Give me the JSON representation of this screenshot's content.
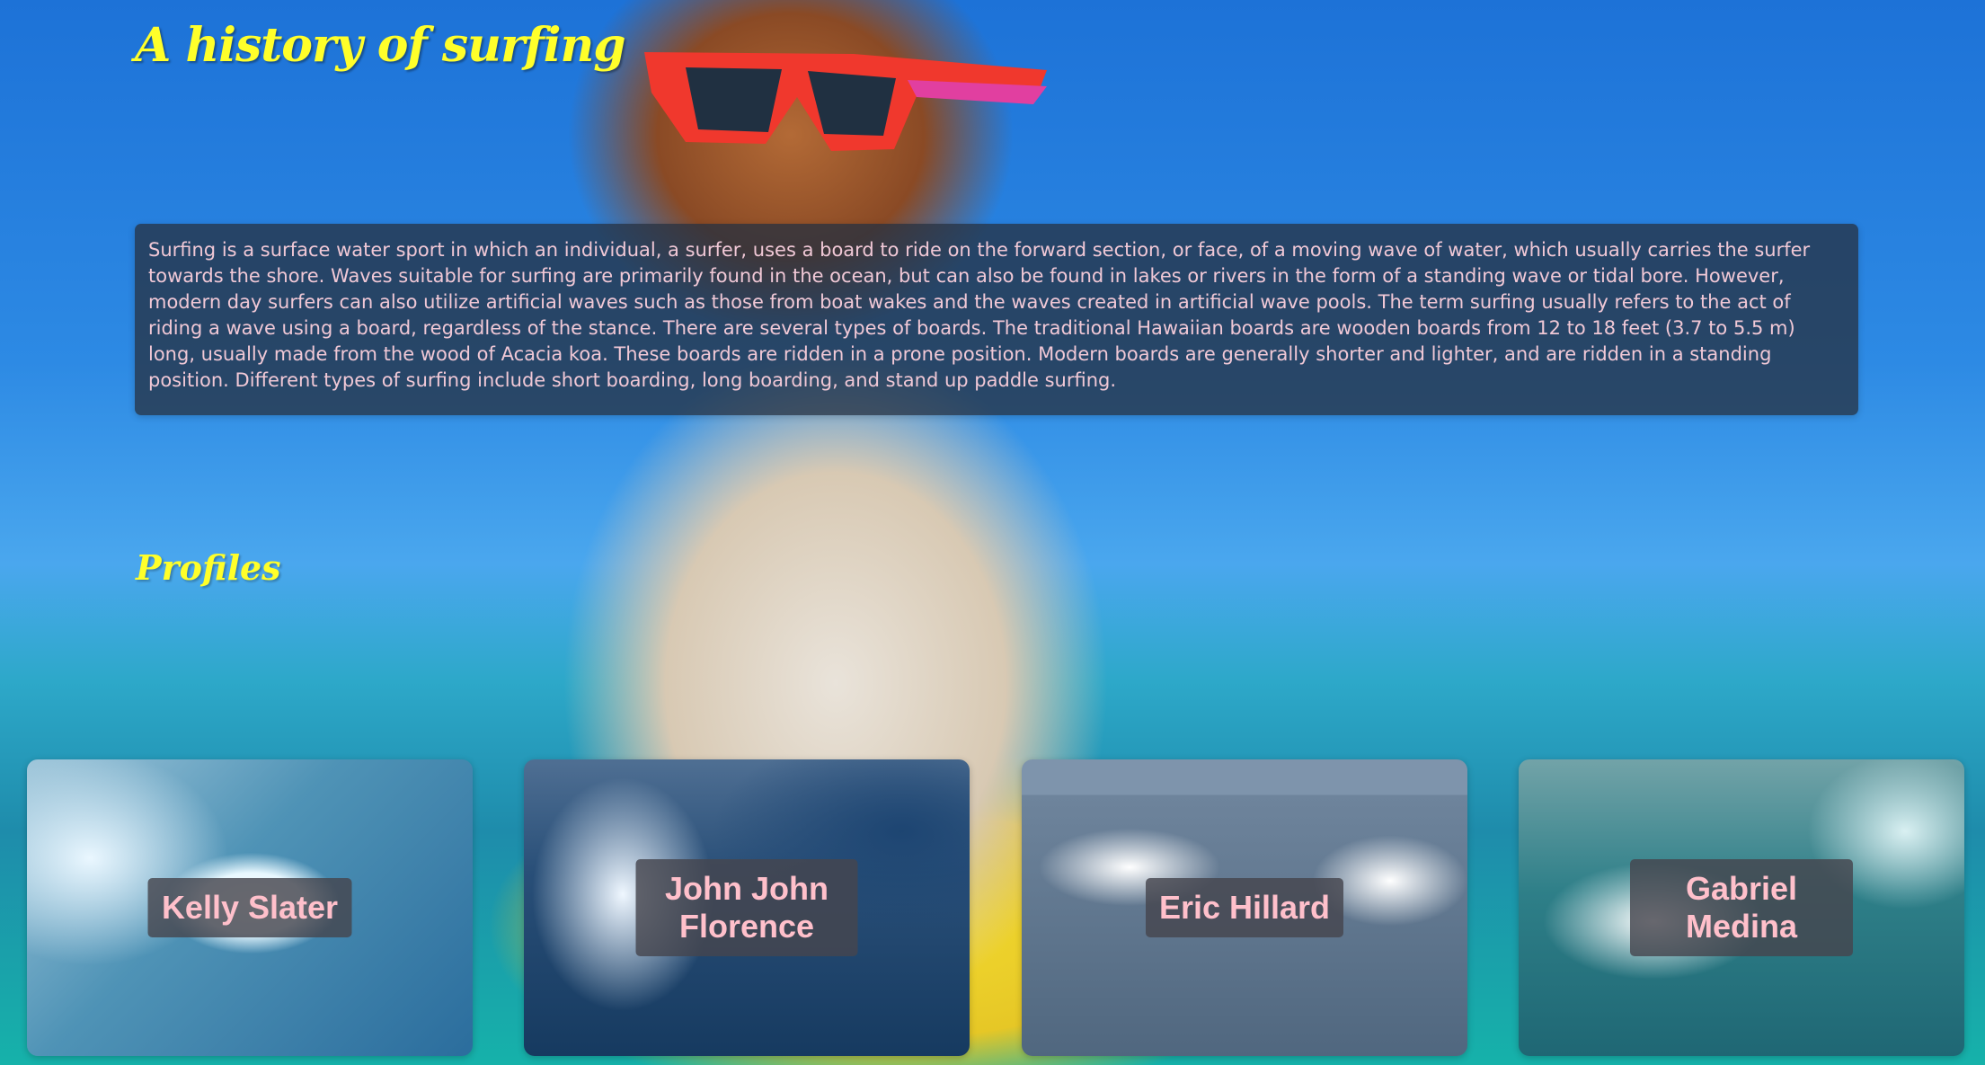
{
  "header": {
    "title": "A history of surfing"
  },
  "intro": {
    "text": "Surfing is a surface water sport in which an individual, a surfer, uses a board to ride on the forward section, or face, of a moving wave of water, which usually carries the surfer towards the shore. Waves suitable for surfing are primarily found in the ocean, but can also be found in lakes or rivers in the form of a standing wave or tidal bore. However, modern day surfers can also utilize artificial waves such as those from boat wakes and the waves created in artificial wave pools. The term surfing usually refers to the act of riding a wave using a board, regardless of the stance. There are several types of boards. The traditional Hawaiian boards are wooden boards from 12 to 18 feet (3.7 to 5.5 m) long, usually made from the wood of Acacia koa. These boards are ridden in a prone position. Modern boards are generally shorter and lighter, and are ridden in a standing position. Different types of surfing include short boarding, long boarding, and stand up paddle surfing."
  },
  "profiles": {
    "title": "Profiles",
    "cards": [
      {
        "name": "Kelly Slater"
      },
      {
        "name": "John John Florence"
      },
      {
        "name": "Eric Hillard"
      },
      {
        "name": "Gabriel Medina"
      }
    ]
  },
  "colors": {
    "title": "#ffff2a",
    "intro_text": "#f0c8d6",
    "intro_background": "#263040",
    "profile_name": "#ffc0cb"
  }
}
